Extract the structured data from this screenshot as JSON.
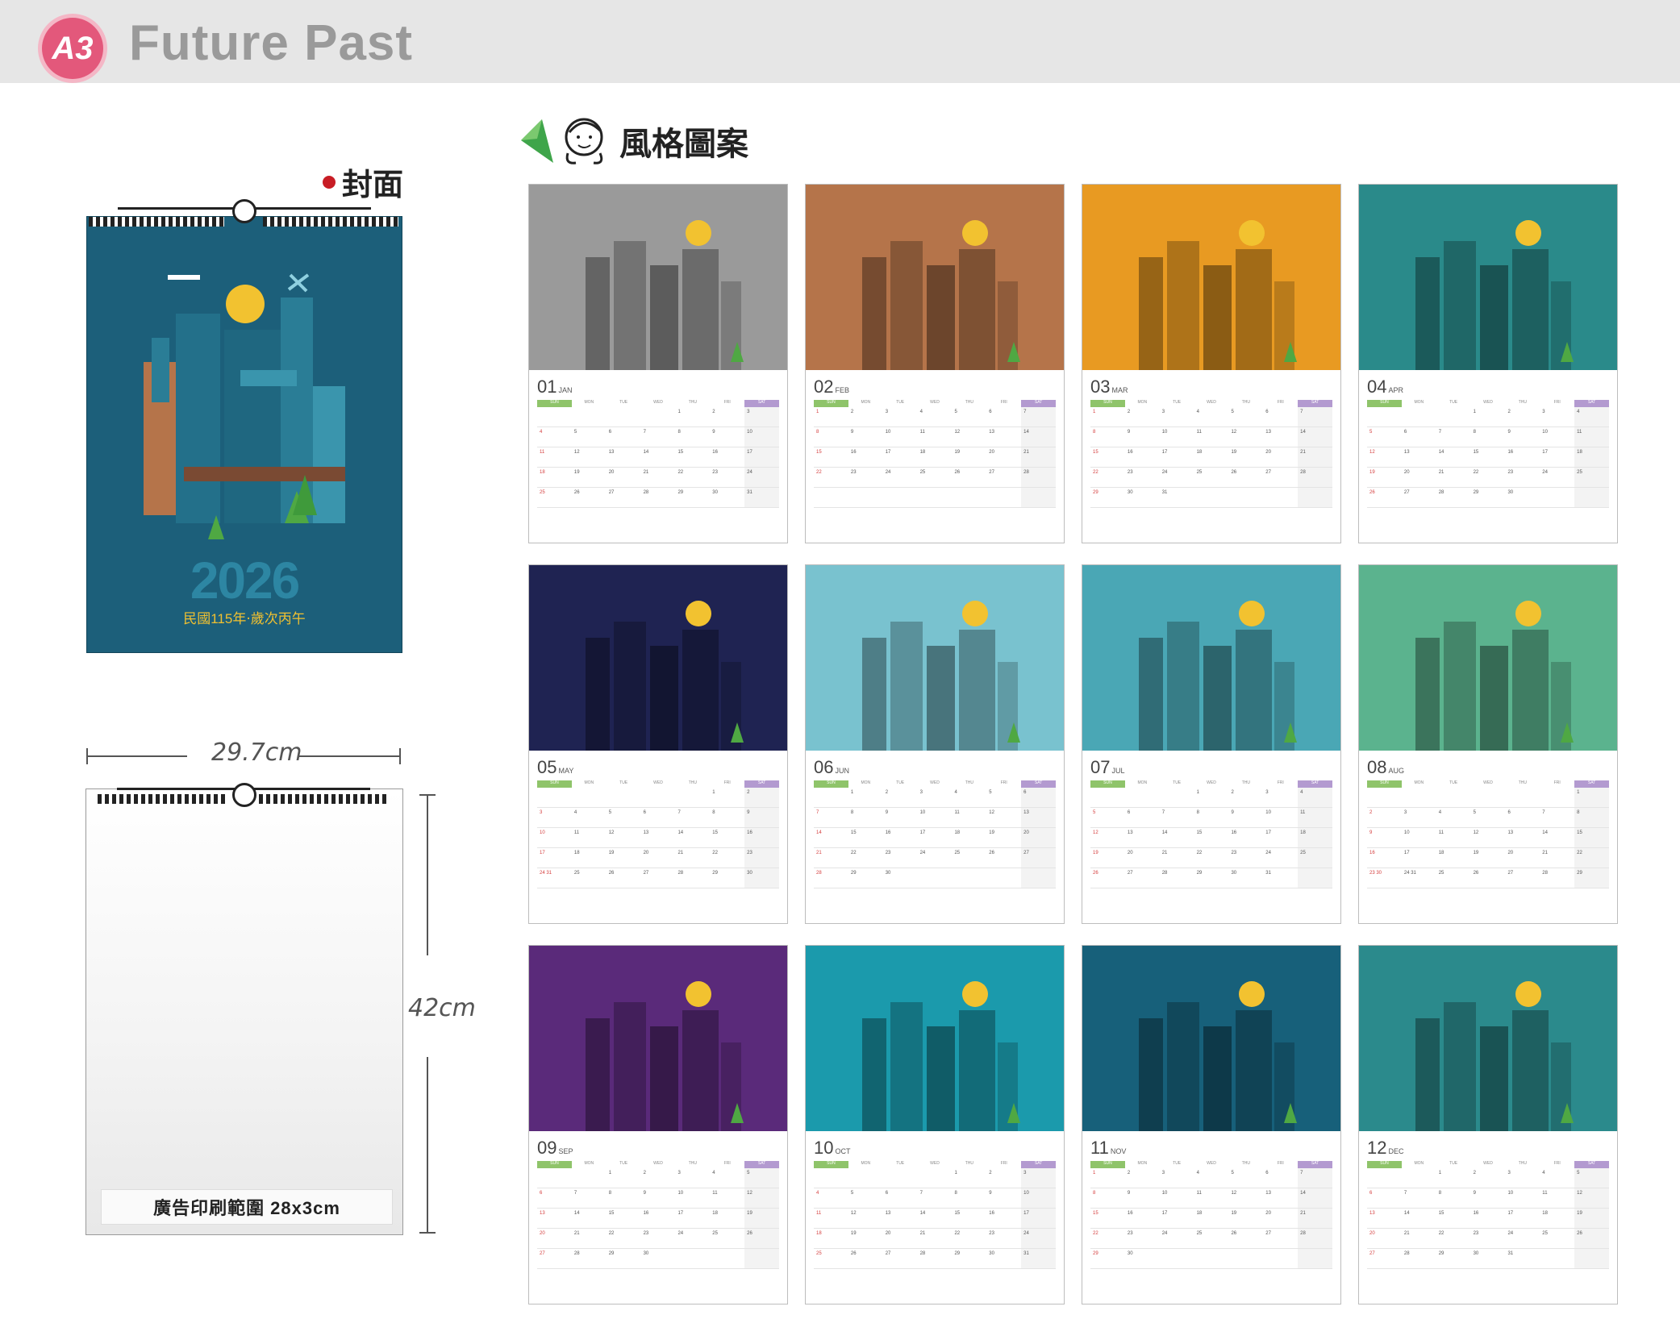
{
  "header": {
    "badge": "A3",
    "title": "Future Past"
  },
  "cover": {
    "label": "封面",
    "year": "2026",
    "subtitle": "民國115年‧歲次丙午"
  },
  "style_label": "風格圖案",
  "dimensions": {
    "width": "29.7cm",
    "height": "42cm"
  },
  "ad_area": "廣告印刷範圍 28x3cm",
  "weekdays": [
    "SUN",
    "MON",
    "TUE",
    "WED",
    "THU",
    "FRI",
    "SAT"
  ],
  "months": [
    {
      "num": "01",
      "name": "JAN",
      "bg": "#9a9a9a"
    },
    {
      "num": "02",
      "name": "FEB",
      "bg": "#b5744a"
    },
    {
      "num": "03",
      "name": "MAR",
      "bg": "#e89a22"
    },
    {
      "num": "04",
      "name": "APR",
      "bg": "#2a8a8a"
    },
    {
      "num": "05",
      "name": "MAY",
      "bg": "#1f2352"
    },
    {
      "num": "06",
      "name": "JUN",
      "bg": "#79c2cf"
    },
    {
      "num": "07",
      "name": "JUL",
      "bg": "#4aa7b5"
    },
    {
      "num": "08",
      "name": "AUG",
      "bg": "#5bb38e"
    },
    {
      "num": "09",
      "name": "SEP",
      "bg": "#5a2a7a"
    },
    {
      "num": "10",
      "name": "OCT",
      "bg": "#1b9aac"
    },
    {
      "num": "11",
      "name": "NOV",
      "bg": "#17607a"
    },
    {
      "num": "12",
      "name": "DEC",
      "bg": "#2b8a8c"
    }
  ],
  "colors": {
    "badge": "#e3587b",
    "topbar": "#e6e6e6",
    "cover": "#1c5f7a"
  }
}
